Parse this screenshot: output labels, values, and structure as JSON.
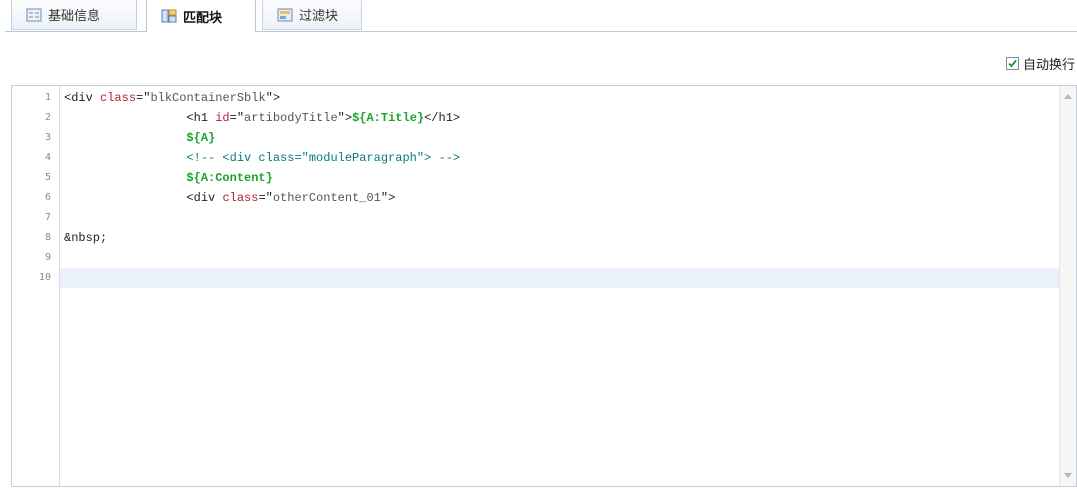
{
  "tabs": [
    {
      "label": "基础信息",
      "icon": "form-icon",
      "active": false
    },
    {
      "label": "匹配块",
      "icon": "blocks-icon",
      "active": true
    },
    {
      "label": "过滤块",
      "icon": "filter-icon",
      "active": false
    }
  ],
  "toolbar": {
    "wrap_label": "自动换行",
    "wrap_checked": true
  },
  "editor": {
    "active_line": 10,
    "line_numbers": [
      "1",
      "2",
      "3",
      "4",
      "5",
      "6",
      "7",
      "8",
      "9",
      "10"
    ],
    "lines": [
      [
        {
          "t": "<div ",
          "c": "tag"
        },
        {
          "t": "class",
          "c": "attr"
        },
        {
          "t": "=\"",
          "c": "tag"
        },
        {
          "t": "blkContainerSblk",
          "c": "val"
        },
        {
          "t": "\">",
          "c": "tag"
        }
      ],
      [
        {
          "t": "                 ",
          "c": "text"
        },
        {
          "t": "<h1 ",
          "c": "tag"
        },
        {
          "t": "id",
          "c": "attr"
        },
        {
          "t": "=\"",
          "c": "tag"
        },
        {
          "t": "artibodyTitle",
          "c": "val"
        },
        {
          "t": "\">",
          "c": "tag"
        },
        {
          "t": "${A:Title}",
          "c": "var"
        },
        {
          "t": "</h1>",
          "c": "tag"
        }
      ],
      [
        {
          "t": "                 ",
          "c": "text"
        },
        {
          "t": "${A}",
          "c": "var"
        }
      ],
      [
        {
          "t": "                 ",
          "c": "text"
        },
        {
          "t": "<!-- <div class=\"moduleParagraph\"> -->",
          "c": "comment"
        }
      ],
      [
        {
          "t": "                 ",
          "c": "text"
        },
        {
          "t": "${A:Content}",
          "c": "var"
        }
      ],
      [
        {
          "t": "                 ",
          "c": "text"
        },
        {
          "t": "<div ",
          "c": "tag"
        },
        {
          "t": "class",
          "c": "attr"
        },
        {
          "t": "=\"",
          "c": "tag"
        },
        {
          "t": "otherContent_01",
          "c": "val"
        },
        {
          "t": "\">",
          "c": "tag"
        }
      ],
      [],
      [
        {
          "t": "&nbsp;",
          "c": "text"
        }
      ],
      [],
      []
    ]
  },
  "colors": {
    "accent": "#b9c9dc",
    "active_line": "#eaf1fb",
    "attr": "#b0242f",
    "var": "#1aa52c",
    "comment": "#0a7b7b"
  }
}
